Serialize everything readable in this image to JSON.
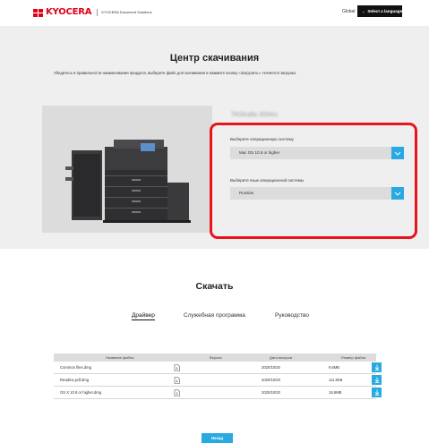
{
  "header": {
    "logo_text": "KYOCERA",
    "logo_subtitle": "KYOCERA Document Solutions",
    "global_link": "Global",
    "language_button": "Select a language"
  },
  "hero": {
    "title": "Центр скачивания",
    "description": "Убедитесь в правильности наименования продукта, выберите файл для скачивания и нажмите кнопку «Загрузить». Начнется загрузка.",
    "product_name": "TASKalfa 3554ci",
    "os_label": "Выберите операционную систему",
    "os_value": "Mac OS 10.5 or higher",
    "lang_label": "Выберите язык операционной системы",
    "lang_value": "Russian"
  },
  "download": {
    "title": "Скачать",
    "tabs": [
      {
        "label": "Драйвер",
        "active": true
      },
      {
        "label": "Служебная программа",
        "active": false
      },
      {
        "label": "Руководство",
        "active": false
      }
    ]
  },
  "table": {
    "headers": [
      "Название файла",
      "Версия",
      "Дата выпуска",
      "Размер файла"
    ],
    "rows": [
      {
        "name": "Common files.dmg",
        "version": "",
        "date": "2020/10/20",
        "size": "9.6MB"
      },
      {
        "name": "Readme.pdf.dmg",
        "version": "",
        "date": "2020/10/20",
        "size": "111.8KB"
      },
      {
        "name": "OS X 10.9 or higher.dmg",
        "version": "",
        "date": "2020/10/20",
        "size": "18.6MB"
      }
    ]
  },
  "back_button": "Назад",
  "colors": {
    "accent": "#29a9e1",
    "brand": "#e2001a",
    "highlight": "#e8141c"
  },
  "icons": [
    "chevron-down-icon",
    "file-icon",
    "download-icon"
  ]
}
